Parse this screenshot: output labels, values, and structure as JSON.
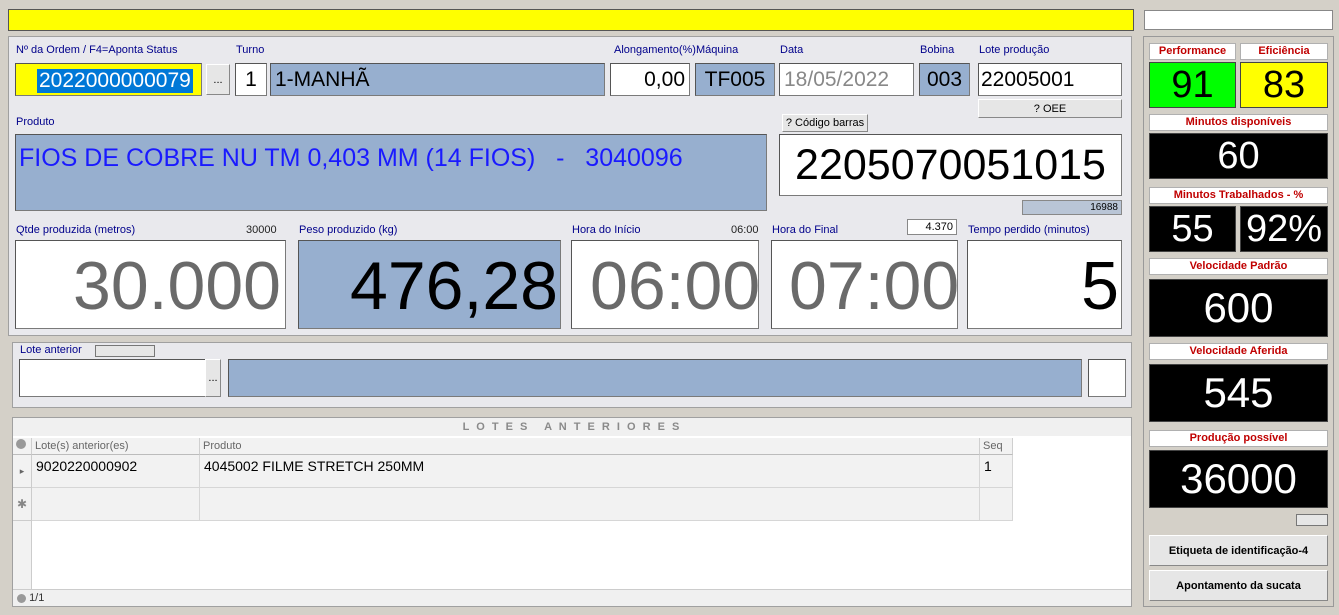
{
  "header": {
    "status_bar_text": ""
  },
  "order": {
    "label": "Nº da Ordem / F4=Aponta Status",
    "value": "2022000000079",
    "lookup_label": "..."
  },
  "shift": {
    "label": "Turno",
    "number": "1",
    "name": "1-MANHÃ"
  },
  "elongation": {
    "label": "Alongamento(%)",
    "value": "0,00"
  },
  "machine": {
    "label": "Máquina",
    "value": "TF005"
  },
  "date": {
    "label": "Data",
    "value": "18/05/2022"
  },
  "coil": {
    "label": "Bobina",
    "value": "003"
  },
  "lot": {
    "label": "Lote produção",
    "value": "22005001",
    "oee_button": "? OEE"
  },
  "product": {
    "label": "Produto",
    "value": "FIOS DE COBRE NU TM 0,403 MM (14 FIOS)   -   3040096"
  },
  "barcode": {
    "button": "? Código barras",
    "value": "2205070051015",
    "sub_value": "16988"
  },
  "qty": {
    "label": "Qtde produzida (metros)",
    "target": "30000",
    "value": "30.000"
  },
  "weight": {
    "label": "Peso produzido (kg)",
    "value": "476,28"
  },
  "start": {
    "label": "Hora do Início",
    "hint": "06:00",
    "value": "06:00"
  },
  "end": {
    "label": "Hora do Final",
    "hint": "4.370",
    "value": "07:00"
  },
  "lost": {
    "label": "Tempo perdido (minutos)",
    "value": "5"
  },
  "prev_lot": {
    "label": "Lote anterior",
    "lookup_label": "...",
    "value": "",
    "desc": ""
  },
  "lots_section": {
    "title": "L O T E S   A N T E R I O R E S",
    "columns": [
      "Lote(s) anterior(es)",
      "Produto",
      "Seq"
    ],
    "rows": [
      {
        "lot": "9020220000902",
        "product": "4045002  FILME STRETCH 250MM",
        "seq": "1"
      }
    ],
    "footer": "1/1"
  },
  "kpi": {
    "performance_label": "Performance",
    "performance_value": "91",
    "efficiency_label": "Eficiência",
    "efficiency_value": "83",
    "available_label": "Minutos disponíveis",
    "available_value": "60",
    "worked_label": "Minutos Trabalhados - %",
    "worked_value": "55",
    "worked_pct": "92%",
    "std_speed_label": "Velocidade Padrão",
    "std_speed_value": "600",
    "measured_speed_label": "Velocidade Aferida",
    "measured_speed_value": "545",
    "possible_prod_label": "Produção  possível",
    "possible_prod_value": "36000"
  },
  "actions": {
    "label_button": "Etiqueta de identificação-4",
    "scrap_button": "Apontamento da sucata"
  },
  "colors": {
    "performance_bg": "#00ff00",
    "efficiency_bg": "#ffff00",
    "readonly_bg": "#97afcf",
    "product_text": "#1a1aff",
    "kpi_title": "#c00000"
  }
}
